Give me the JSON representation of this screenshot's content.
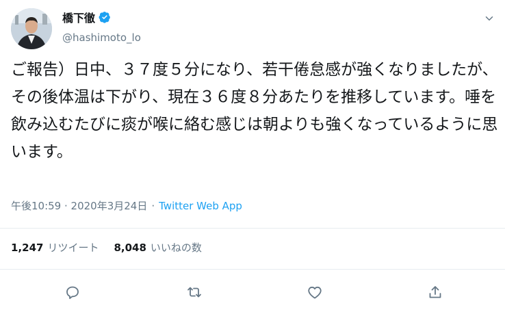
{
  "author": {
    "display_name": "橋下徹",
    "handle": "@hashimoto_lo",
    "verified": true
  },
  "tweet": {
    "text": "ご報告）日中、３７度５分になり、若干倦怠感が強くなりましたが、その後体温は下がり、現在３６度８分あたりを推移しています。唾を飲み込むたびに痰が喉に絡む感じは朝よりも強くなっているように思います。",
    "timestamp": "午後10:59 · 2020年3月24日",
    "separator": "·",
    "source": "Twitter Web App"
  },
  "stats": {
    "retweets_count": "1,247",
    "retweets_label": "リツイート",
    "likes_count": "8,048",
    "likes_label": "いいねの数"
  },
  "icons": {
    "reply": "reply-icon",
    "retweet": "retweet-icon",
    "like": "like-icon",
    "share": "share-icon",
    "verified": "verified-badge-icon",
    "caret": "chevron-down-icon"
  },
  "colors": {
    "accent": "#1da1f2",
    "text_primary": "#14171a",
    "text_secondary": "#657786",
    "divider": "#e6ecf0"
  }
}
